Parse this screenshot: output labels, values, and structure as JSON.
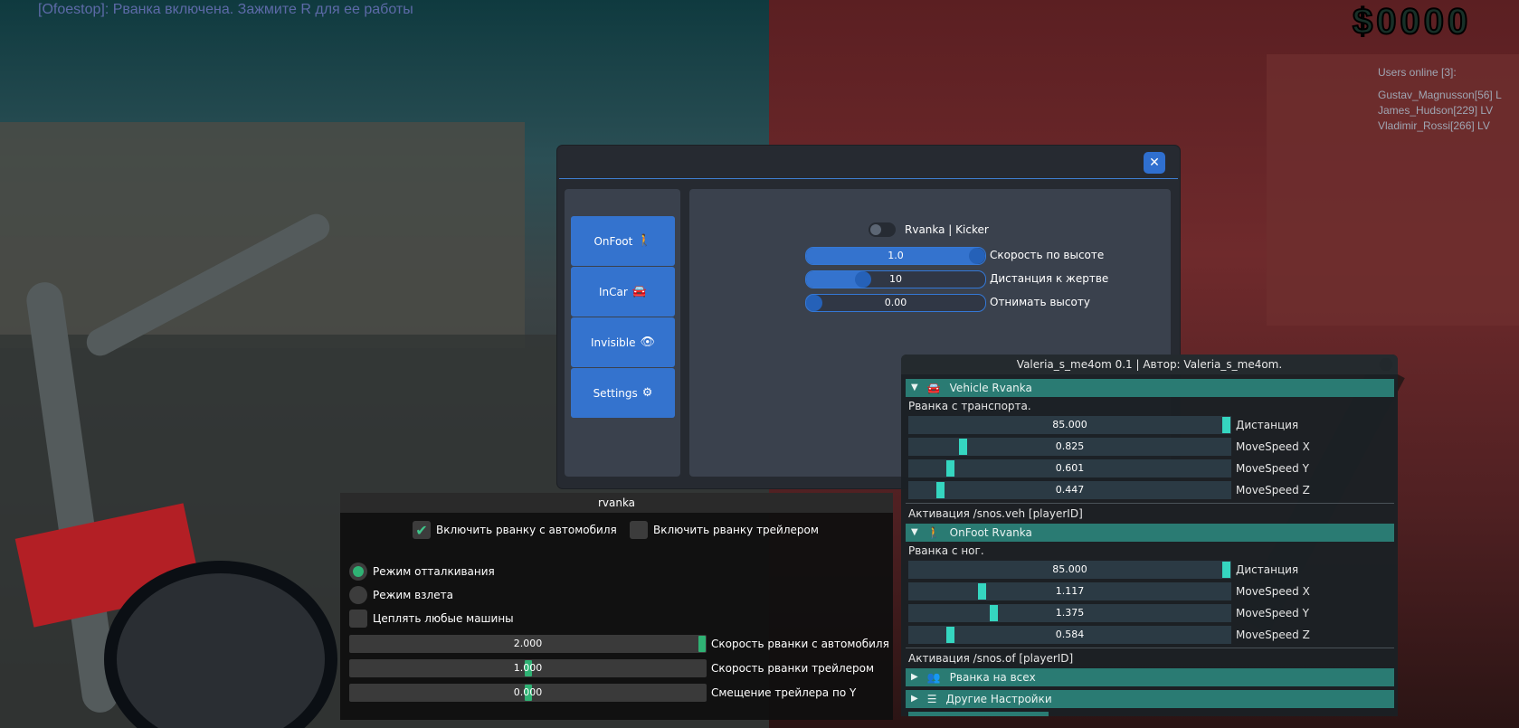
{
  "hud": {
    "message": "[Ofoestop]: Рванка включена. Зажмите R для ее работы",
    "money": "$0000",
    "users_title": "Users online [3]:",
    "users": [
      "Gustav_Magnusson[56] L",
      "James_Hudson[229] LV",
      "Vladimir_Rossi[266] LV"
    ]
  },
  "main": {
    "close_label": "✕",
    "nav": [
      {
        "label": "OnFoot",
        "icon": "🚶",
        "icon_name": "walking-person-icon"
      },
      {
        "label": "InCar",
        "icon": "🚘",
        "icon_name": "car-icon"
      },
      {
        "label": "Invisible",
        "icon": "👁",
        "icon_name": "eye-slash-icon"
      },
      {
        "label": "Settings",
        "icon": "⚙",
        "icon_name": "gear-icon"
      }
    ],
    "toggle_label": "Rvanka | Kicker",
    "toggle_on": false,
    "sliders": [
      {
        "value": "1.0",
        "label": "Скорость по высоте",
        "fraction": 1.0
      },
      {
        "value": "10",
        "label": "Дистанция к жертве",
        "fraction": 0.3
      },
      {
        "value": "0.00",
        "label": "Отнимать высоту",
        "fraction": 0.0
      }
    ]
  },
  "rvanka": {
    "title": "rvanka",
    "checkboxes": [
      {
        "label": "Включить рванку с автомобиля",
        "checked": true
      },
      {
        "label": "Включить рванку трейлером",
        "checked": false
      }
    ],
    "radios": [
      {
        "label": "Режим отталкивания",
        "selected": true
      },
      {
        "label": "Режим взлета",
        "selected": false
      }
    ],
    "checkbox_any": {
      "label": "Цеплять любые машины",
      "checked": false
    },
    "sliders": [
      {
        "value": "2.000",
        "label": "Скорость рванки с автомобиля",
        "fraction": 1.0
      },
      {
        "value": "1.000",
        "label": "Скорость рванки трейлером",
        "fraction": 0.5
      },
      {
        "value": "0.000",
        "label": "Смещение трейлера по Y",
        "fraction": 0.5
      }
    ]
  },
  "valeria": {
    "title": "Valeria_s_me4om 0.1 | Автор: Valeria_s_me4om.",
    "vehicle": {
      "header": "Vehicle Rvanka",
      "subtitle": "Рванка с транспорта.",
      "sliders": [
        {
          "value": "85.000",
          "label": "Дистанция",
          "fraction": 1.0
        },
        {
          "value": "0.825",
          "label": "MoveSpeed X",
          "fraction": 0.16
        },
        {
          "value": "0.601",
          "label": "MoveSpeed Y",
          "fraction": 0.12
        },
        {
          "value": "0.447",
          "label": "MoveSpeed Z",
          "fraction": 0.09
        }
      ],
      "activation": "Активация /snos.veh [playerID]"
    },
    "onfoot": {
      "header": "OnFoot Rvanka",
      "subtitle": "Рванка с ног.",
      "sliders": [
        {
          "value": "85.000",
          "label": "Дистанция",
          "fraction": 1.0
        },
        {
          "value": "1.117",
          "label": "MoveSpeed X",
          "fraction": 0.22
        },
        {
          "value": "1.375",
          "label": "MoveSpeed Y",
          "fraction": 0.26
        },
        {
          "value": "0.584",
          "label": "MoveSpeed Z",
          "fraction": 0.12
        }
      ],
      "activation": "Активация /snos.of [playerID]"
    },
    "collapsed": [
      {
        "label": "Рванка на всех",
        "icon": "👥",
        "icon_name": "users-icon"
      },
      {
        "label": "Другие Настройки",
        "icon": "☰",
        "icon_name": "list-icon"
      }
    ]
  }
}
